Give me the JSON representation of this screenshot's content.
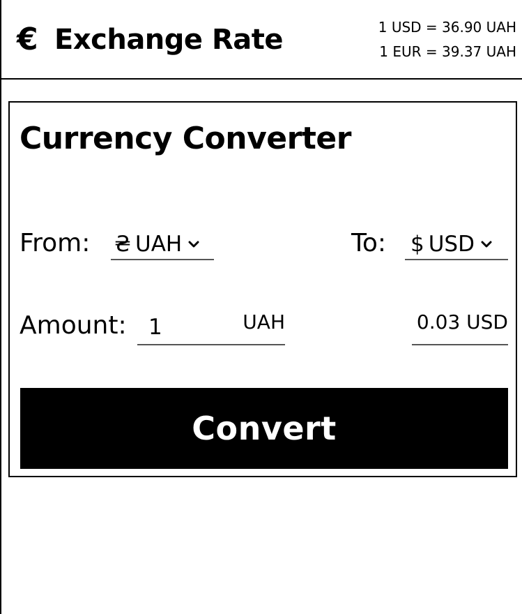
{
  "header": {
    "logo_icon": "€",
    "title": "Exchange Rate",
    "rates": [
      "1 USD = 36.90 UAH",
      "1 EUR = 39.37 UAH"
    ]
  },
  "converter": {
    "title": "Currency Converter",
    "from_label": "From:",
    "from_select": {
      "symbol": "₴",
      "value": "UAH"
    },
    "to_label": "To:",
    "to_select": {
      "symbol": "$",
      "value": "USD"
    },
    "amount_label": "Amount:",
    "amount_value": "1",
    "amount_unit": "UAH",
    "result": "0.03 USD",
    "convert_label": "Convert"
  }
}
